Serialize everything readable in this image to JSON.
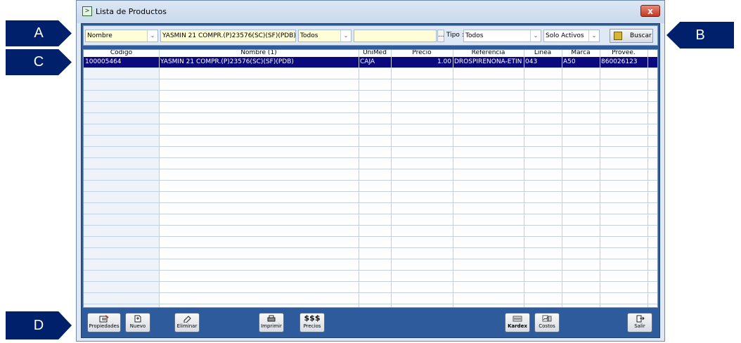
{
  "callouts": {
    "a": "A",
    "b": "B",
    "c": "C",
    "d": "D"
  },
  "window": {
    "title": "Lista de Productos",
    "close_label": "x"
  },
  "filters": {
    "field_select": "Nombre",
    "search_text": "YASMIN 21 COMPR.(P)23576(SC)(SF)(PDB)",
    "scope_select": "Todos",
    "extra_text": "",
    "ellipsis": "...",
    "tipo_label": "Tipo :",
    "tipo_select": "Todos",
    "status_select": "Solo Activos",
    "buscar_label": "Buscar"
  },
  "table": {
    "headers": [
      "Código",
      "Nombre (1)",
      "UniMed",
      "Precio",
      "Referencia",
      "Linea",
      "Marca",
      "Provee."
    ],
    "rows": [
      [
        "100005464",
        "YASMIN 21 COMPR.(P)23576(SC)(SF)(PDB)",
        "CAJA",
        "1.00",
        "DROSPIRENONA-ETINILE",
        "043",
        "A50",
        "860026123"
      ]
    ]
  },
  "footer": {
    "propiedades": "Propiedades",
    "nuevo": "Nuevo",
    "eliminar": "Eliminar",
    "imprimir": "Imprimir",
    "precios_symbol": "$$$",
    "precios": "Precios",
    "kardex": "Kardex",
    "costos": "Costos",
    "salir": "Salir"
  },
  "colors": {
    "callout": "#00206b",
    "panel": "#2e5b9c",
    "selection": "#0a0a7e",
    "field_bg": "#fffed6"
  }
}
